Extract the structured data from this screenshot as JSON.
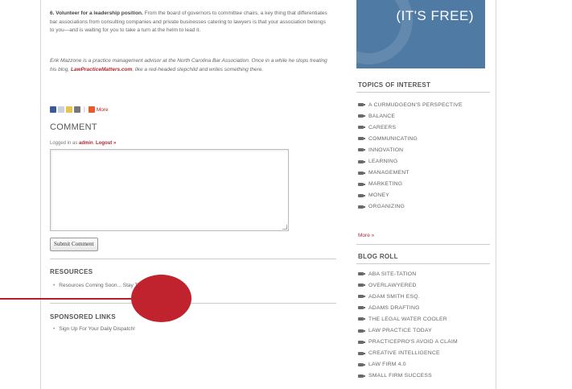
{
  "article": {
    "p1_num": "6.",
    "p1_bold": " Volunteer for a leadership position.",
    "p1_text": " From the board of governors to committee chairs, a key thing that differentiates bar associations from consulting companies and private businesses catering to lawyers is that your association belongs to you—and is waiting for you to take a turn at the helm to lead it.",
    "p2_a": "Erik Mazzone is a practice management advisor at the North Carolina Bar Association. Once in a while he stops treating his blog, ",
    "p2_link": "LawPracticeMatters.com",
    "p2_b": ", like a red-headed stepchild and writes something there."
  },
  "share": {
    "more_label": "More"
  },
  "comment": {
    "heading": "COMMENT",
    "logged_prefix": "Logged in as ",
    "user": "admin",
    "logout": "Logout »",
    "submit_label": "Submit Comment"
  },
  "resources": {
    "heading": "RESOURCES",
    "items": [
      "Resources Coming Soon... Stay Tuned!"
    ]
  },
  "sponsored": {
    "heading": "SPONSORED LINKS",
    "items": [
      "Sign Up For Your Daily Dispatch!"
    ]
  },
  "sidebar": {
    "banner_text": "(IT'S FREE)",
    "topics_heading": "TOPICS OF INTEREST",
    "topics": [
      "A CURMUDGEON'S PERSPECTIVE",
      "BALANCE",
      "CAREERS",
      "COMMUNICATING",
      "INNOVATION",
      "LEARNING",
      "MANAGEMENT",
      "MARKETING",
      "MONEY",
      "ORGANIZING"
    ],
    "more_label": "More »",
    "blogroll_heading": "BLOG ROLL",
    "blogroll": [
      "ABA SITE-TATION",
      "OVERLAWYERED",
      "ADAM SMITH ESQ.",
      "ADAMS DRAFTING",
      "THE LEGAL WATER COOLER",
      "LAW PRACTICE TODAY",
      "PRACTICEPRO'S AVOID A CLAIM",
      "CREATIVE INTELLIGENCE",
      "LAW FIRM 4.0",
      "SMALL FIRM SUCCESS"
    ]
  },
  "colors": {
    "accent_red": "#b2282e",
    "banner_blue": "#4e7aa3",
    "callout_red": "#c0222e"
  }
}
